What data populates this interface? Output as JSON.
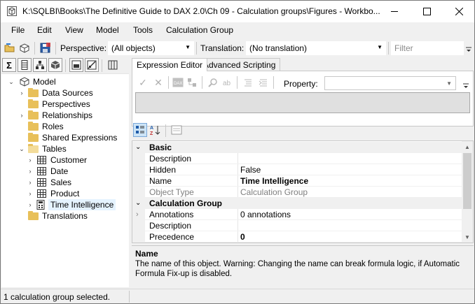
{
  "window": {
    "title": "K:\\SQLBI\\Books\\The Definitive Guide to DAX 2.0\\Ch 09 - Calculation groups\\Figures - Workbo...",
    "minimize_icon": "minimize-icon",
    "maximize_icon": "maximize-icon",
    "close_icon": "close-icon"
  },
  "menu": {
    "items": [
      {
        "label": "File",
        "key": "F"
      },
      {
        "label": "Edit",
        "key": "E"
      },
      {
        "label": "View",
        "key": "V"
      },
      {
        "label": "Model",
        "key": "M"
      },
      {
        "label": "Tools",
        "key": "T"
      },
      {
        "label": "Calculation Group",
        "key": "C"
      }
    ]
  },
  "toolbar": {
    "perspective_label": "Perspective:",
    "perspective_value": "(All objects)",
    "translation_label": "Translation:",
    "translation_value": "(No translation)",
    "filter_placeholder": "Filter"
  },
  "tree": {
    "root": "Model",
    "items": [
      {
        "label": "Data Sources",
        "icon": "folder-icon",
        "expandable": true
      },
      {
        "label": "Perspectives",
        "icon": "folder-icon",
        "expandable": false
      },
      {
        "label": "Relationships",
        "icon": "folder-icon",
        "expandable": true
      },
      {
        "label": "Roles",
        "icon": "folder-icon",
        "expandable": false
      },
      {
        "label": "Shared Expressions",
        "icon": "folder-icon",
        "expandable": false
      },
      {
        "label": "Tables",
        "icon": "folder-icon",
        "expandable": true,
        "expanded": true
      },
      {
        "label": "Customer",
        "icon": "table-icon",
        "expandable": true
      },
      {
        "label": "Date",
        "icon": "table-icon",
        "expandable": true
      },
      {
        "label": "Sales",
        "icon": "table-icon",
        "expandable": true
      },
      {
        "label": "Product",
        "icon": "table-icon",
        "expandable": true
      },
      {
        "label": "Time Intelligence",
        "icon": "calculation-group-icon",
        "expandable": true,
        "selected": true
      },
      {
        "label": "Translations",
        "icon": "folder-icon",
        "expandable": false
      }
    ]
  },
  "tabs": {
    "expression_editor": "Expression Editor",
    "advanced_scripting": "Advanced Scripting"
  },
  "expression": {
    "property_label": "Property:",
    "property_value": ""
  },
  "properties": {
    "categories": [
      {
        "name": "Basic",
        "rows": [
          {
            "name": "Description",
            "value": "",
            "bold": false,
            "readonly": false
          },
          {
            "name": "Hidden",
            "value": "False",
            "bold": false,
            "readonly": false
          },
          {
            "name": "Name",
            "value": "Time Intelligence",
            "bold": true,
            "readonly": false
          },
          {
            "name": "Object Type",
            "value": "Calculation Group",
            "bold": false,
            "readonly": true
          }
        ]
      },
      {
        "name": "Calculation Group",
        "rows": [
          {
            "name": "Annotations",
            "value": "0 annotations",
            "bold": false,
            "readonly": false,
            "expandable": true
          },
          {
            "name": "Description",
            "value": "",
            "bold": false,
            "readonly": false
          },
          {
            "name": "Precedence",
            "value": "0",
            "bold": true,
            "readonly": false
          }
        ]
      }
    ]
  },
  "description": {
    "title": "Name",
    "text": "The name of this object. Warning: Changing the name can break formula logic, if Automatic Formula Fix-up is disabled."
  },
  "status": {
    "text": "1 calculation group selected."
  }
}
